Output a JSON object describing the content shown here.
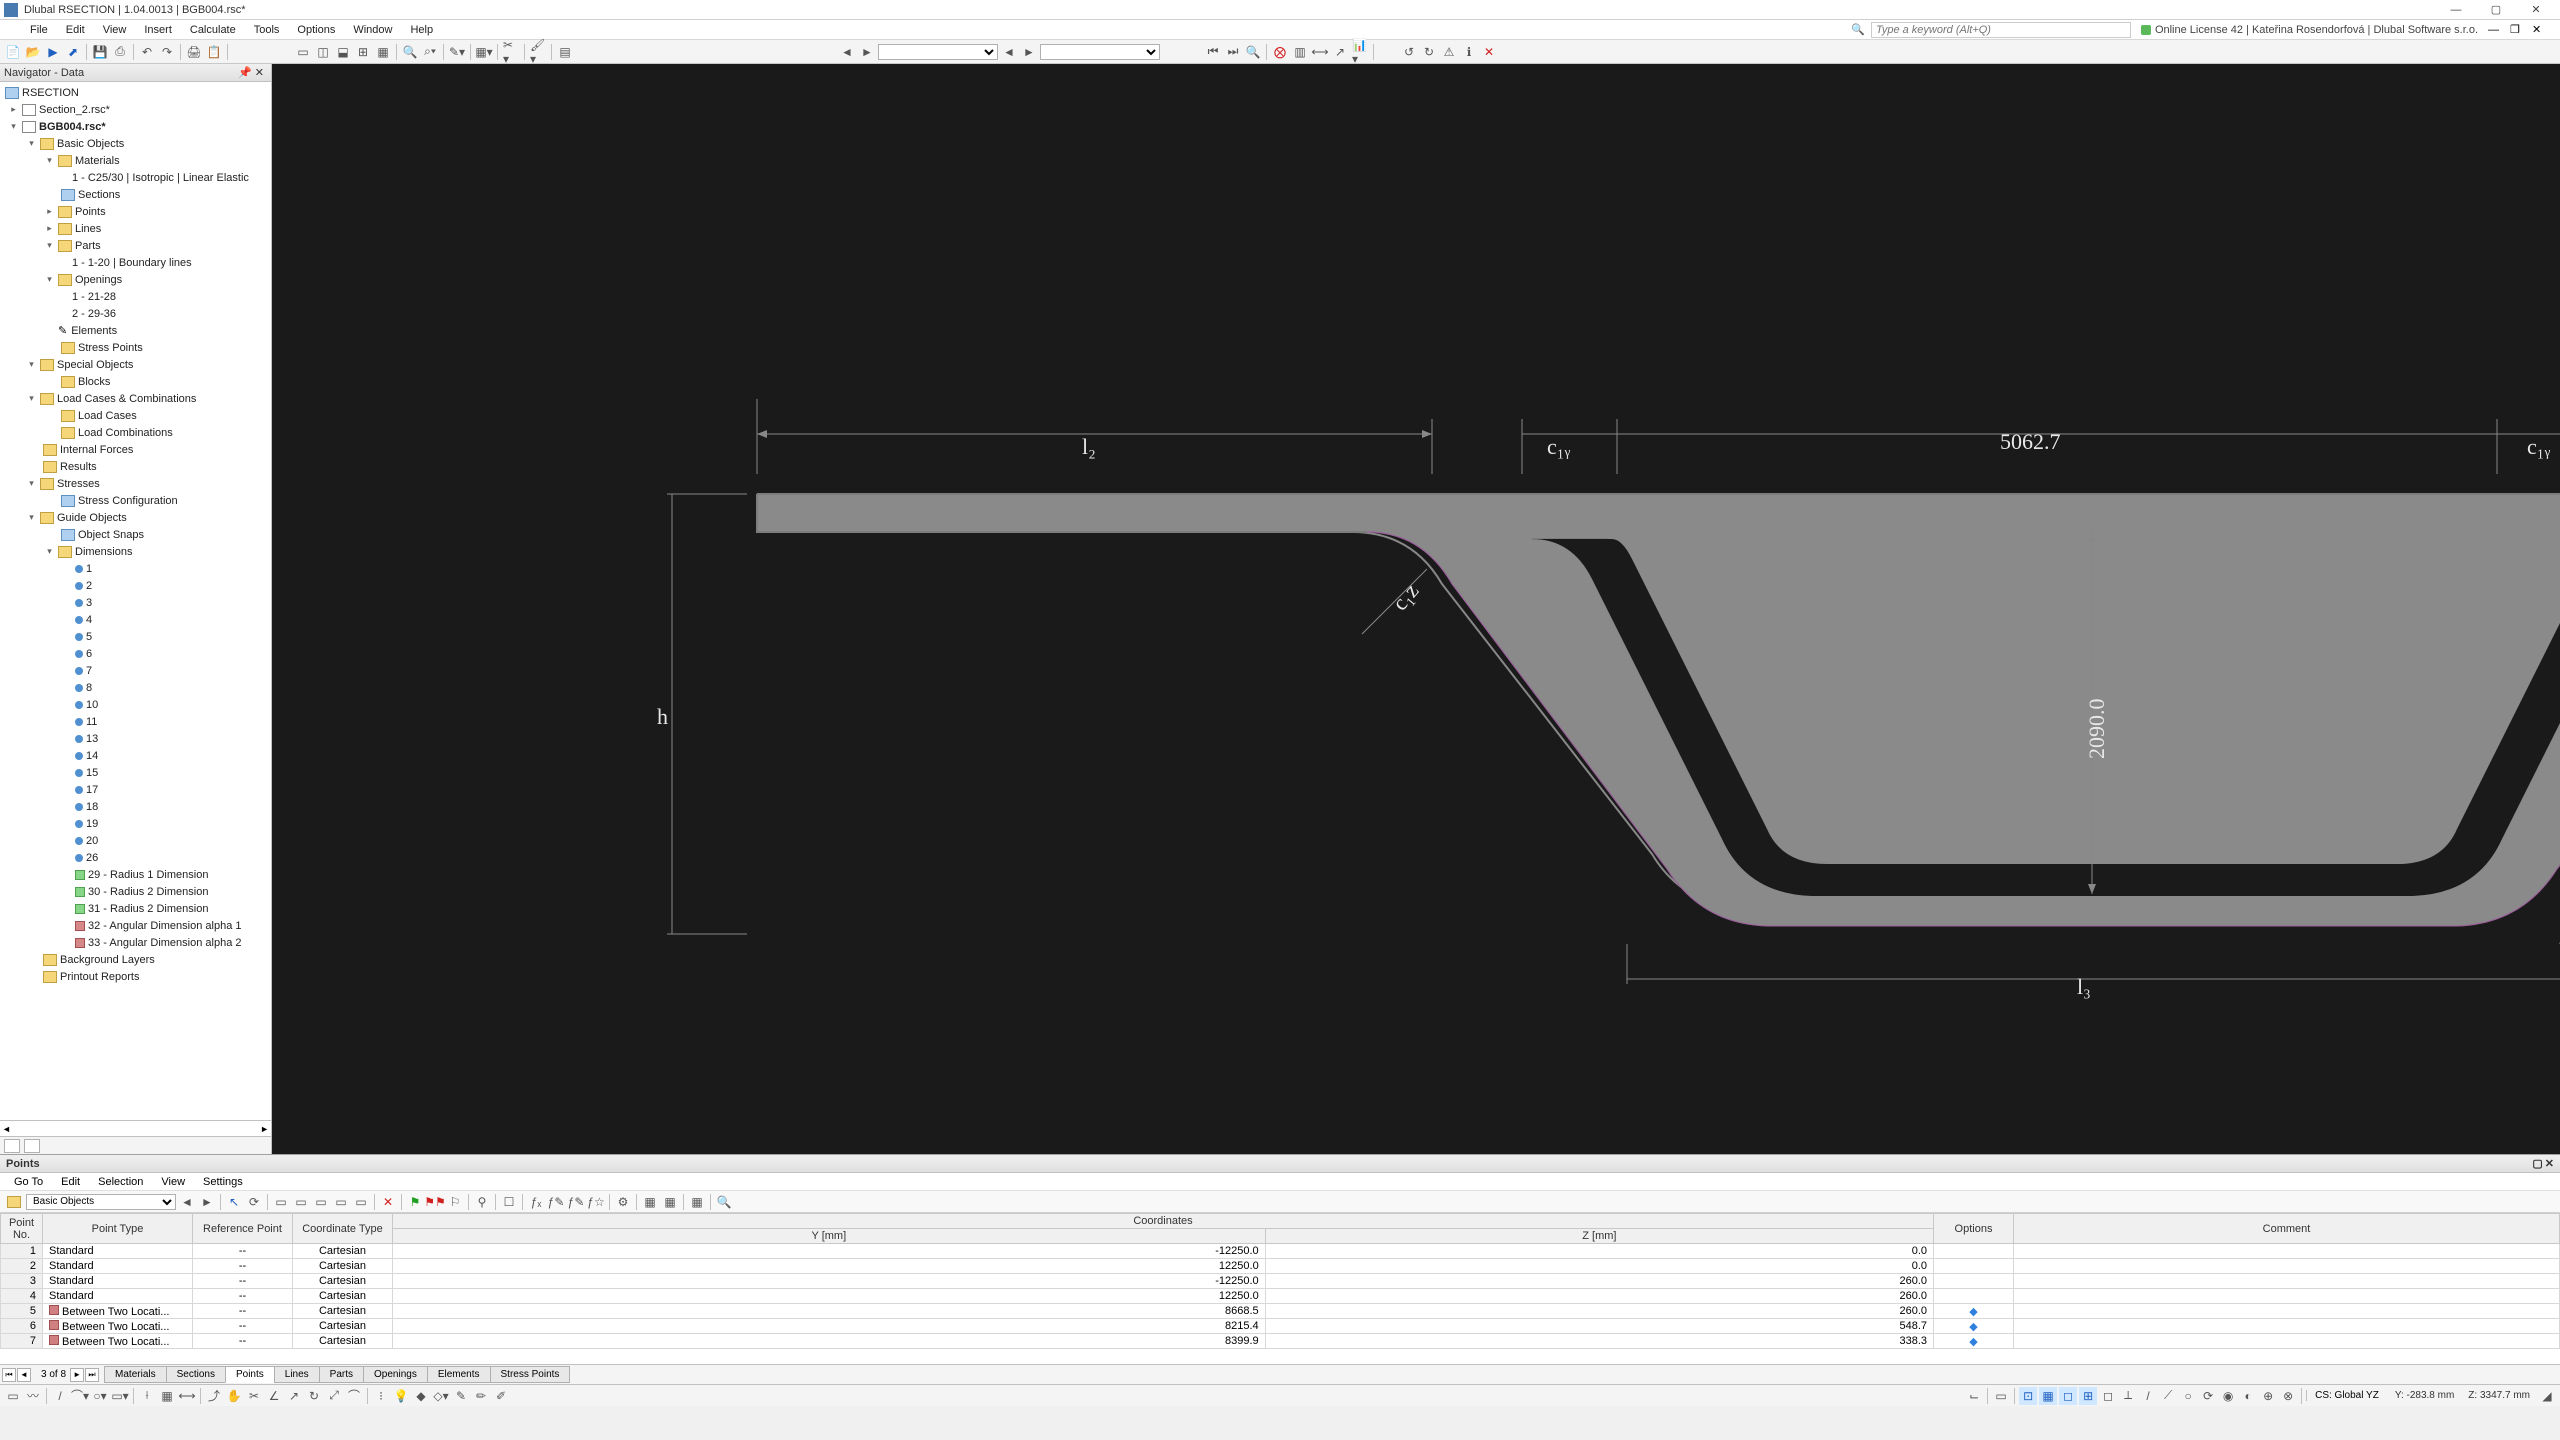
{
  "title": "Dlubal RSECTION | 1.04.0013 | BGB004.rsc*",
  "menus": [
    "File",
    "Edit",
    "View",
    "Insert",
    "Calculate",
    "Tools",
    "Options",
    "Window",
    "Help"
  ],
  "search_placeholder": "Type a keyword (Alt+Q)",
  "license": "Online License 42 | Kateřina Rosendorfová | Dlubal Software s.r.o.",
  "nav_title": "Navigator - Data",
  "tree": {
    "root": "RSECTION",
    "files": [
      "Section_2.rsc*",
      "BGB004.rsc*"
    ],
    "basic_objects": "Basic Objects",
    "materials": "Materials",
    "material1": "1 - C25/30 | Isotropic | Linear Elastic",
    "sections": "Sections",
    "points": "Points",
    "lines": "Lines",
    "parts": "Parts",
    "parts1": "1 - 1-20 | Boundary lines",
    "openings": "Openings",
    "open1": "1 - 21-28",
    "open2": "2 - 29-36",
    "elements": "Elements",
    "stress_points": "Stress Points",
    "special": "Special Objects",
    "blocks": "Blocks",
    "lcc": "Load Cases & Combinations",
    "load_cases": "Load Cases",
    "load_combos": "Load Combinations",
    "internal": "Internal Forces",
    "results": "Results",
    "stresses": "Stresses",
    "stress_cfg": "Stress Configuration",
    "guide": "Guide Objects",
    "snaps": "Object Snaps",
    "dimensions": "Dimensions",
    "dim_items": [
      "1",
      "2",
      "3",
      "4",
      "5",
      "6",
      "7",
      "8",
      "10",
      "11",
      "13",
      "14",
      "15",
      "17",
      "18",
      "19",
      "20",
      "26"
    ],
    "dim29": "29 - Radius 1 Dimension",
    "dim30": "30 - Radius 2 Dimension",
    "dim31": "31 - Radius 2 Dimension",
    "dim32": "32 - Angular Dimension alpha 1",
    "dim33": "33 - Angular Dimension alpha 2",
    "bglayers": "Background Layers",
    "printout": "Printout Reports"
  },
  "viewport_dims": {
    "l2": "l₂",
    "c1y_left": "c₁ᵧ",
    "top_val": "5062.7",
    "c1y_right": "c₁ᵧ",
    "h": "h",
    "c1z": "c₁z",
    "vert": "2090.0",
    "l3": "l₃"
  },
  "panel": {
    "title": "Points",
    "menus": [
      "Go To",
      "Edit",
      "Selection",
      "View",
      "Settings"
    ],
    "combo": "Basic Objects",
    "page": "3 of 8",
    "tabs": [
      "Materials",
      "Sections",
      "Points",
      "Lines",
      "Parts",
      "Openings",
      "Elements",
      "Stress Points"
    ],
    "active_tab": 2,
    "headers_top": [
      "Point No.",
      "Point Type",
      "Reference Point",
      "Coordinate Type",
      "Coordinates",
      "Options",
      "Comment"
    ],
    "headers_sub": [
      "",
      "",
      "",
      "",
      "Y [mm]",
      "Z [mm]",
      "",
      ""
    ],
    "rows": [
      {
        "no": "1",
        "type": "Standard",
        "ref": "--",
        "ct": "Cartesian",
        "y": "-12250.0",
        "z": "0.0",
        "opt": ""
      },
      {
        "no": "2",
        "type": "Standard",
        "ref": "--",
        "ct": "Cartesian",
        "y": "12250.0",
        "z": "0.0",
        "opt": ""
      },
      {
        "no": "3",
        "type": "Standard",
        "ref": "--",
        "ct": "Cartesian",
        "y": "-12250.0",
        "z": "260.0",
        "opt": ""
      },
      {
        "no": "4",
        "type": "Standard",
        "ref": "--",
        "ct": "Cartesian",
        "y": "12250.0",
        "z": "260.0",
        "opt": ""
      },
      {
        "no": "5",
        "type": "Between Two Locati...",
        "ref": "--",
        "ct": "Cartesian",
        "y": "8668.5",
        "z": "260.0",
        "opt": "◆"
      },
      {
        "no": "6",
        "type": "Between Two Locati...",
        "ref": "--",
        "ct": "Cartesian",
        "y": "8215.4",
        "z": "548.7",
        "opt": "◆"
      },
      {
        "no": "7",
        "type": "Between Two Locati...",
        "ref": "--",
        "ct": "Cartesian",
        "y": "8399.9",
        "z": "338.3",
        "opt": "◆"
      }
    ]
  },
  "status": {
    "cs": "CS: Global YZ",
    "y": "Y: -283.8 mm",
    "z": "Z: 3347.7 mm"
  }
}
